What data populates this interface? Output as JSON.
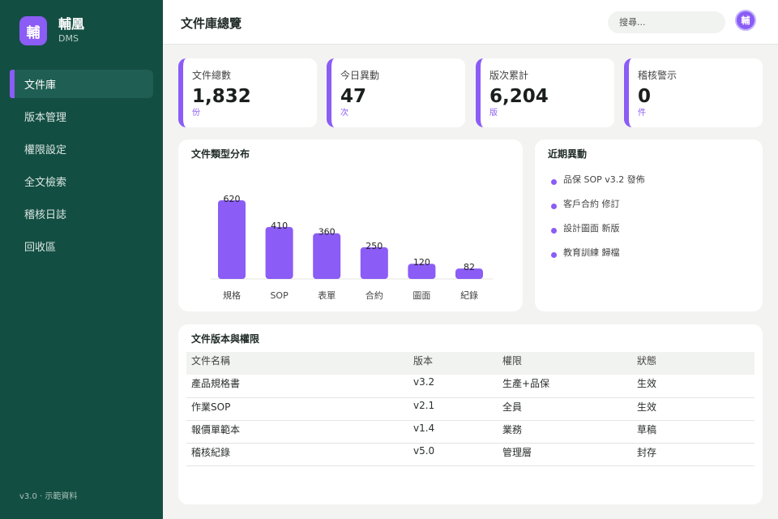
{
  "brand": {
    "logo_char": "輔",
    "name": "輔凰",
    "sub": "DMS"
  },
  "nav": {
    "items": [
      {
        "label": "文件庫"
      },
      {
        "label": "版本管理"
      },
      {
        "label": "權限設定"
      },
      {
        "label": "全文檢索"
      },
      {
        "label": "稽核日誌"
      },
      {
        "label": "回收區"
      }
    ],
    "active_index": 0
  },
  "sidebar_footer": "v3.0 · 示範資料",
  "header": {
    "title": "文件庫總覽",
    "search_placeholder": "搜尋...",
    "avatar_char": "輔"
  },
  "stats": [
    {
      "label": "文件總數",
      "value": "1,832",
      "unit": "份"
    },
    {
      "label": "今日異動",
      "value": "47",
      "unit": "次"
    },
    {
      "label": "版次累計",
      "value": "6,204",
      "unit": "版"
    },
    {
      "label": "稽核警示",
      "value": "0",
      "unit": "件"
    }
  ],
  "chart_panel_title": "文件類型分布",
  "chart_data": {
    "type": "bar",
    "categories": [
      "規格",
      "SOP",
      "表單",
      "合約",
      "圖面",
      "紀錄"
    ],
    "values": [
      620,
      410,
      360,
      250,
      120,
      82
    ],
    "title": "",
    "xlabel": "",
    "ylabel": "",
    "ylim": [
      0,
      620
    ],
    "grid": false,
    "legend": "none",
    "bar_color": "#8b5cf6"
  },
  "activity": {
    "title": "近期異動",
    "items": [
      "品保 SOP v3.2 發佈",
      "客戶合約 修訂",
      "設計圖面 新版",
      "教育訓練 歸檔"
    ]
  },
  "table": {
    "title": "文件版本與權限",
    "headers": [
      "文件名稱",
      "版本",
      "權限",
      "狀態"
    ],
    "rows": [
      [
        "產品規格書",
        "v3.2",
        "生產+品保",
        "生效"
      ],
      [
        "作業SOP",
        "v2.1",
        "全員",
        "生效"
      ],
      [
        "報價單範本",
        "v1.4",
        "業務",
        "草稿"
      ],
      [
        "稽核紀錄",
        "v5.0",
        "管理層",
        "封存"
      ]
    ]
  },
  "colors": {
    "accent": "#8b5cf6",
    "sidebar": "#134e43",
    "background": "#f3f4f1"
  }
}
